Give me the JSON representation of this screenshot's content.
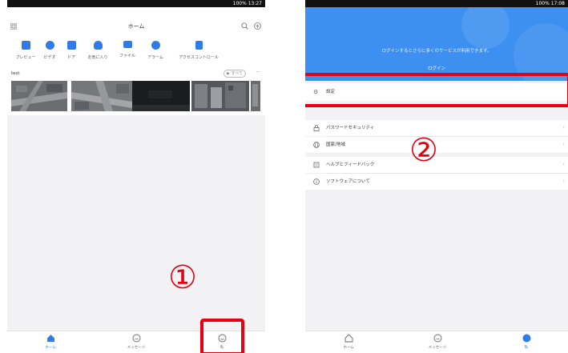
{
  "left": {
    "status": {
      "text": "100% 13:27"
    },
    "header": {
      "title": "ホーム",
      "grid_icon": "grid-icon",
      "search_icon": "search-icon",
      "add_icon": "add-icon"
    },
    "shortcuts": [
      {
        "label": "プレビュー",
        "icon": "camera-icon"
      },
      {
        "label": "ビデオ",
        "icon": "video-icon"
      },
      {
        "label": "ドア",
        "icon": "door-icon"
      },
      {
        "label": "お気に入り",
        "icon": "heart-icon"
      },
      {
        "label": "ファイル",
        "icon": "folder-icon"
      },
      {
        "label": "アラーム",
        "icon": "alarm-icon"
      },
      {
        "label": "アクセスコントロール",
        "icon": "access-control-icon"
      }
    ],
    "section": {
      "title": "test",
      "all_label": "すべて",
      "more": "···"
    },
    "tabs": [
      {
        "label": "ホーム",
        "icon": "home-icon"
      },
      {
        "label": "メッセージ",
        "icon": "message-icon"
      },
      {
        "label": "私",
        "icon": "me-icon"
      }
    ],
    "annotation": "①"
  },
  "right": {
    "status": {
      "text": "100% 17:08"
    },
    "hero": {
      "message": "ログインするとさらに多くのサービスが利用できます。",
      "button": "ログイン"
    },
    "menu": [
      {
        "label": "設定",
        "icon": "settings-icon"
      },
      {
        "label": "パスワードセキュリティ",
        "icon": "lock-icon"
      },
      {
        "label": "国家/地域",
        "icon": "globe-icon"
      },
      {
        "label": "ヘルプとフィードバック",
        "icon": "help-icon"
      },
      {
        "label": "ソフトウェアについて",
        "icon": "info-icon"
      }
    ],
    "tabs": [
      {
        "label": "ホーム",
        "icon": "home-icon"
      },
      {
        "label": "メッセージ",
        "icon": "message-icon"
      },
      {
        "label": "私",
        "icon": "me-icon"
      }
    ],
    "annotation": "②"
  },
  "colors": {
    "accent": "#2f7bea",
    "hero": "#3d8ff0",
    "annotation": "#e60012"
  }
}
